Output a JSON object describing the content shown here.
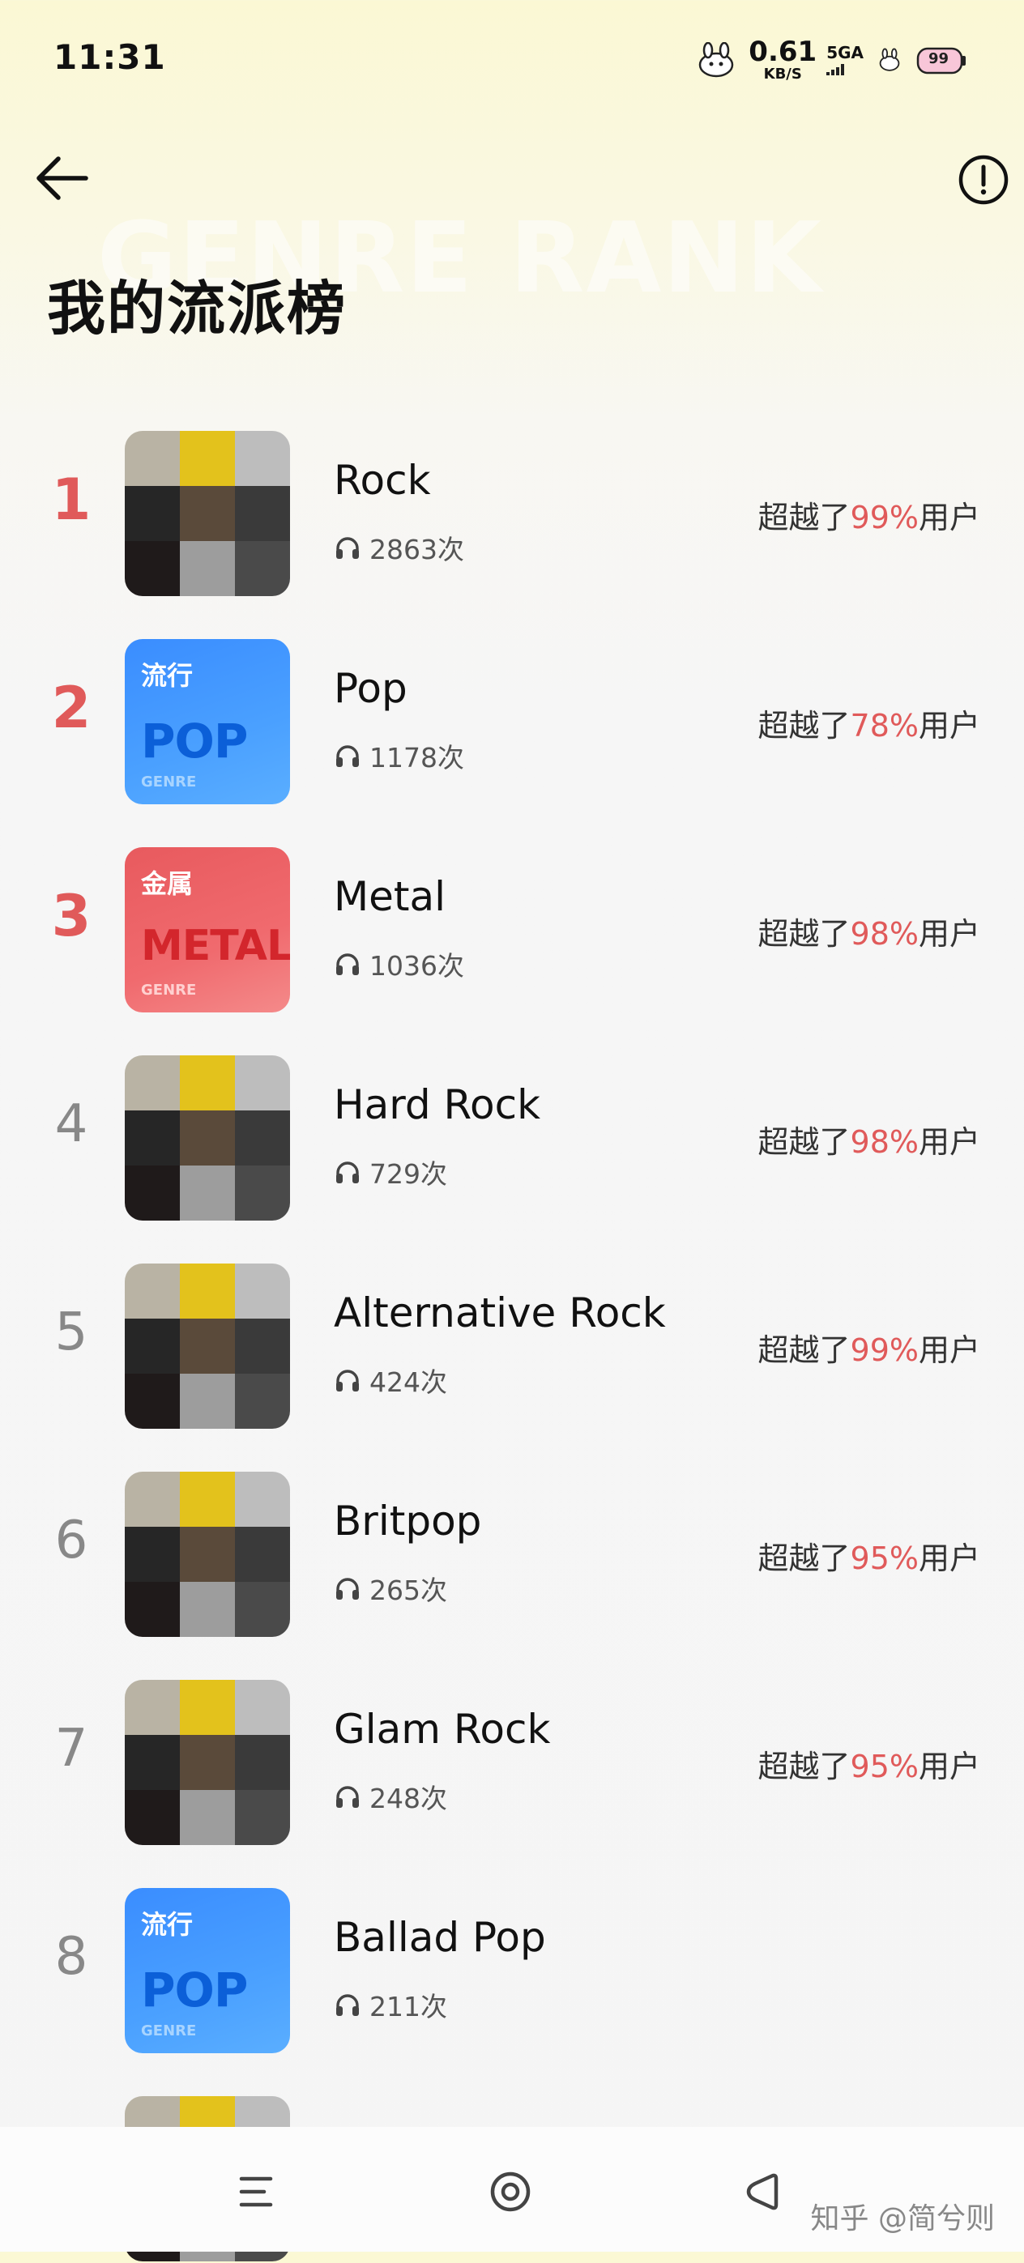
{
  "status_bar": {
    "time": "11:31",
    "speed_value": "0.61",
    "speed_unit": "KB/S",
    "network": "5GA",
    "battery": "99"
  },
  "header": {
    "watermark_text": "GENRE RANK",
    "title": "我的流派榜"
  },
  "beat_prefix": "超越了",
  "beat_suffix": "用户",
  "accent_color": "#e05a5a",
  "genres": [
    {
      "rank": "1",
      "name": "Rock",
      "plays": "2863次",
      "percent": "99%",
      "cover": "mosaic"
    },
    {
      "rank": "2",
      "name": "Pop",
      "plays": "1178次",
      "percent": "78%",
      "cover": "pop"
    },
    {
      "rank": "3",
      "name": "Metal",
      "plays": "1036次",
      "percent": "98%",
      "cover": "metal"
    },
    {
      "rank": "4",
      "name": "Hard Rock",
      "plays": "729次",
      "percent": "98%",
      "cover": "mosaic"
    },
    {
      "rank": "5",
      "name": "Alternative Rock",
      "plays": "424次",
      "percent": "99%",
      "cover": "mosaic"
    },
    {
      "rank": "6",
      "name": "Britpop",
      "plays": "265次",
      "percent": "95%",
      "cover": "mosaic"
    },
    {
      "rank": "7",
      "name": "Glam Rock",
      "plays": "248次",
      "percent": "95%",
      "cover": "mosaic"
    },
    {
      "rank": "8",
      "name": "Ballad Pop",
      "plays": "211次",
      "percent": "",
      "cover": "pop"
    }
  ],
  "cover_cards": {
    "pop": {
      "cn": "流行",
      "en": "POP",
      "genre": "GENRE"
    },
    "metal": {
      "cn": "金属",
      "en": "METAL",
      "genre": "GENRE"
    }
  },
  "footer": {
    "watermark": "知乎 @简兮则"
  }
}
